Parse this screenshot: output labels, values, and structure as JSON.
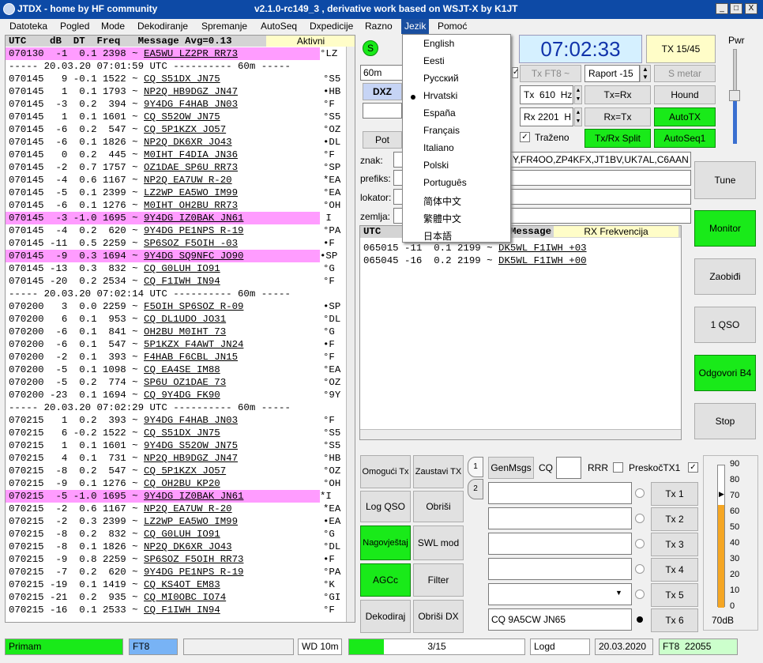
{
  "window": {
    "title_left": "JTDX - home  by HF community",
    "title_right": "v2.1.0-rc149_3 , derivative work based on WSJT-X by K1JT",
    "min": "_",
    "max": "□",
    "close": "X"
  },
  "menu": [
    "Datoteka",
    "Pogled",
    "Mode",
    "Dekodiranje",
    "Spremanje",
    "AutoSeq",
    "Dxpedicije",
    "Razno",
    "Jezik",
    "Pomoć"
  ],
  "language_menu": {
    "items": [
      "English",
      "Eesti",
      "Русский",
      "Hrvatski",
      "España",
      "Français",
      "Italiano",
      "Polski",
      "Português",
      "简体中文",
      "繁體中文",
      "日本語"
    ],
    "selected": "Hrvatski"
  },
  "left_log": {
    "header": "UTC    dB  DT  Freq   Message Avg=0.13",
    "header_tag": "Aktivni",
    "rows": [
      {
        "t": "070130  -1  0.1 2398 ~ ",
        "m": "EA5WU LZ2PR RR73",
        "s": "°LZ",
        "hl": true
      },
      {
        "t": "----- 20.03.20 07:01:59 UTC ---------- 60m -----",
        "m": "",
        "s": "",
        "hl": false
      },
      {
        "t": "070145   9 -0.1 1522 ~ ",
        "m": "CQ S51DX JN75",
        "s": "°S5",
        "hl": false
      },
      {
        "t": "070145   1  0.1 1793 ~ ",
        "m": "NP2Q HB9DGZ JN47",
        "s": "•HB",
        "hl": false
      },
      {
        "t": "070145  -3  0.2  394 ~ ",
        "m": "9Y4DG F4HAB JN03",
        "s": "°F",
        "hl": false
      },
      {
        "t": "070145   1  0.1 1601 ~ ",
        "m": "CQ S52OW JN75",
        "s": "°S5",
        "hl": false
      },
      {
        "t": "070145  -6  0.2  547 ~ ",
        "m": "CQ 5P1KZX JO57",
        "s": "°OZ",
        "hl": false
      },
      {
        "t": "070145  -6  0.1 1826 ~ ",
        "m": "NP2Q DK6XR JO43",
        "s": "•DL",
        "hl": false
      },
      {
        "t": "070145   0  0.2  445 ~ ",
        "m": "M0IHT F4DIA JN36",
        "s": "°F",
        "hl": false
      },
      {
        "t": "070145  -2  0.7 1757 ~ ",
        "m": "OZ1DAE SP6U RR73",
        "s": "°SP",
        "hl": false
      },
      {
        "t": "070145  -4  0.6 1167 ~ ",
        "m": "NP2Q EA7UW R-20",
        "s": "*EA",
        "hl": false
      },
      {
        "t": "070145  -5  0.1 2399 ~ ",
        "m": "LZ2WP EA5WO IM99",
        "s": "°EA",
        "hl": false
      },
      {
        "t": "070145  -6  0.1 1276 ~ ",
        "m": "M0IHT OH2BU RR73",
        "s": "°OH",
        "hl": false
      },
      {
        "t": "070145  -3 -1.0 1695 ~ ",
        "m": "9Y4DG IZ0BAK JN61",
        "s": " I",
        "hl": true
      },
      {
        "t": "070145  -4  0.2  620 ~ ",
        "m": "9Y4DG PE1NPS R-19",
        "s": "°PA",
        "hl": false
      },
      {
        "t": "070145 -11  0.5 2259 ~ ",
        "m": "SP6SOZ F5OIH -03",
        "s": "•F",
        "hl": false
      },
      {
        "t": "070145  -9  0.3 1694 ~ ",
        "m": "9Y4DG SQ9NFC JO90",
        "s": "•SP",
        "hl": true
      },
      {
        "t": "070145 -13  0.3  832 ~ ",
        "m": "CQ G0LUH IO91",
        "s": "°G",
        "hl": false
      },
      {
        "t": "070145 -20  0.2 2534 ~ ",
        "m": "CQ F1IWH IN94",
        "s": "°F",
        "hl": false
      },
      {
        "t": "----- 20.03.20 07:02:14 UTC ---------- 60m -----",
        "m": "",
        "s": "",
        "hl": false
      },
      {
        "t": "070200   3  0.0 2259 ~ ",
        "m": "F5OIH SP6SOZ R-09",
        "s": "•SP",
        "hl": false
      },
      {
        "t": "070200   6  0.1  953 ~ ",
        "m": "CQ DL1UDO JO31",
        "s": "°DL",
        "hl": false
      },
      {
        "t": "070200  -6  0.1  841 ~ ",
        "m": "OH2BU M0IHT 73",
        "s": "°G",
        "hl": false
      },
      {
        "t": "070200  -6  0.1  547 ~ ",
        "m": "5P1KZX F4AWT JN24",
        "s": "•F",
        "hl": false
      },
      {
        "t": "070200  -2  0.1  393 ~ ",
        "m": "F4HAB F6CBL JN15",
        "s": "°F",
        "hl": false
      },
      {
        "t": "070200  -5  0.1 1098 ~ ",
        "m": "CQ EA4SE IM88",
        "s": "°EA",
        "hl": false
      },
      {
        "t": "070200  -5  0.2  774 ~ ",
        "m": "SP6U OZ1DAE 73",
        "s": "°OZ",
        "hl": false
      },
      {
        "t": "070200 -23  0.1 1694 ~ ",
        "m": "CQ 9Y4DG FK90",
        "s": "°9Y",
        "hl": false
      },
      {
        "t": "----- 20.03.20 07:02:29 UTC ---------- 60m -----",
        "m": "",
        "s": "",
        "hl": false
      },
      {
        "t": "070215   1  0.2  393 ~ ",
        "m": "9Y4DG F4HAB JN03",
        "s": "°F",
        "hl": false
      },
      {
        "t": "070215   6 -0.2 1522 ~ ",
        "m": "CQ S51DX JN75",
        "s": "°S5",
        "hl": false
      },
      {
        "t": "070215   1  0.1 1601 ~ ",
        "m": "9Y4DG S52OW JN75",
        "s": "°S5",
        "hl": false
      },
      {
        "t": "070215   4  0.1  731 ~ ",
        "m": "NP2Q HB9DGZ JN47",
        "s": "°HB",
        "hl": false
      },
      {
        "t": "070215  -8  0.2  547 ~ ",
        "m": "CQ 5P1KZX JO57",
        "s": "°OZ",
        "hl": false
      },
      {
        "t": "070215  -9  0.1 1276 ~ ",
        "m": "CQ OH2BU KP20",
        "s": "°OH",
        "hl": false
      },
      {
        "t": "070215  -5 -1.0 1695 ~ ",
        "m": "9Y4DG IZ0BAK JN61",
        "s": "*I",
        "hl": true
      },
      {
        "t": "070215  -2  0.6 1167 ~ ",
        "m": "NP2Q EA7UW R-20",
        "s": "*EA",
        "hl": false
      },
      {
        "t": "070215  -2  0.3 2399 ~ ",
        "m": "LZ2WP EA5WO IM99",
        "s": "•EA",
        "hl": false
      },
      {
        "t": "070215  -8  0.2  832 ~ ",
        "m": "CQ G0LUH IO91",
        "s": "°G",
        "hl": false
      },
      {
        "t": "070215  -8  0.1 1826 ~ ",
        "m": "NP2Q DK6XR JO43",
        "s": "°DL",
        "hl": false
      },
      {
        "t": "070215  -9  0.8 2259 ~ ",
        "m": "SP6SOZ F5OIH RR73",
        "s": "•F",
        "hl": false
      },
      {
        "t": "070215  -7  0.2  620 ~ ",
        "m": "9Y4DG PE1NPS R-19",
        "s": "°PA",
        "hl": false
      },
      {
        "t": "070215 -19  0.1 1419 ~ ",
        "m": "CQ KS4OT EM83",
        "s": "°K",
        "hl": false
      },
      {
        "t": "070215 -21  0.2  935 ~ ",
        "m": "CQ MI0OBC IO74",
        "s": "°GI",
        "hl": false
      },
      {
        "t": "070215 -16  0.1 2533 ~ ",
        "m": "CQ F1IWH IN94",
        "s": "°F",
        "hl": false
      }
    ]
  },
  "controls": {
    "band": "60m",
    "dx_label": "DXZ",
    "pot_label": "Pot",
    "znak_label": "znak:",
    "znak_value": "Y,FR4OO,ZP4KFX,JT1BV,UK7AL,C6AAN",
    "prefiks_label": "prefiks:",
    "lokator_label": "lokator:",
    "zemlja_label": "zemlja:",
    "s_label": "S",
    "clock": "07:02:33",
    "tx_period": "TX 15/45",
    "tx_ft8": "Tx FT8 ~",
    "raport": "Raport -15",
    "s_metar": "S metar",
    "tx_freq": "Tx  610  Hz",
    "rx_freq": "Rx 2201  H",
    "tx_rx": "Tx=Rx",
    "rx_tx": "Rx=Tx",
    "hound": "Hound",
    "autotx": "AutoTX",
    "trazeno": "Traženo",
    "split": "Tx/Rx Split",
    "autoseq": "AutoSeq1",
    "pwr": "Pwr"
  },
  "right_log": {
    "header_utc": "UTC",
    "header_msg": "Message",
    "header_tag": "RX Frekvencija",
    "rows": [
      {
        "t": "065015 -11  0.1 2199 ~ ",
        "m": "DK5WL F1IWH +03"
      },
      {
        "t": "065045 -16  0.2 2199 ~ ",
        "m": "DK5WL F1IWH +00"
      }
    ]
  },
  "side_buttons": [
    "Tune",
    "Monitor",
    "Zaobiđi",
    "1 QSO",
    "Odgovori B4",
    "Stop"
  ],
  "bottom_buttons": [
    "Omogući Tx",
    "Zaustavi TX",
    "Log QSO",
    "Obriši",
    "Nagovještaj",
    "SWL mod",
    "AGCc",
    "Filter",
    "Dekodiraj",
    "Obriši DX"
  ],
  "tabs": [
    "1",
    "2"
  ],
  "msg": {
    "genmsgs": "GenMsgs",
    "cq": "CQ",
    "rrr": "RRR",
    "preskoc": "PreskočTX1",
    "tx": [
      "Tx 1",
      "Tx 2",
      "Tx 3",
      "Tx 4",
      "Tx 5",
      "Tx 6"
    ],
    "tx6_value": "CQ 9A5CW JN65"
  },
  "meter": {
    "ticks": [
      "90",
      "80",
      "70",
      "60",
      "50",
      "40",
      "30",
      "20",
      "10",
      "0"
    ],
    "db": "70dB",
    "level": 0.72
  },
  "statusbar": {
    "rx": "Primam",
    "mode": "FT8",
    "wd": "WD 10m",
    "progress": "3/15",
    "progress_level": 0.2,
    "logd": "Logd",
    "date": "20.03.2020",
    "ft8n": "FT8  22055"
  }
}
